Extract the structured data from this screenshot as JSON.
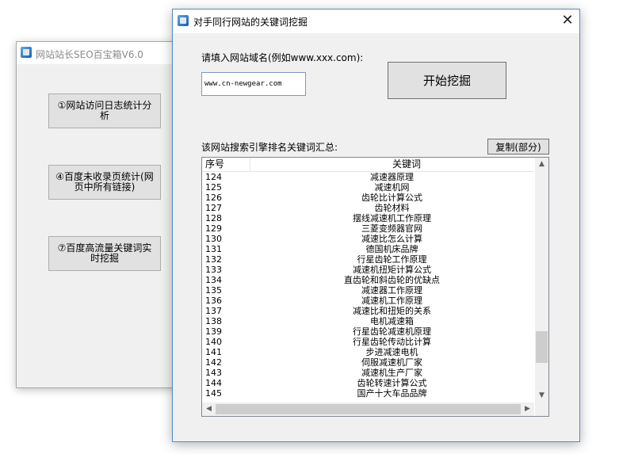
{
  "background_window": {
    "title": "网站站长SEO百宝箱V6.0",
    "buttons": [
      {
        "label": "①网站访问日志统计分析"
      },
      {
        "label": "④百度未收录页统计(网页中所有链接)"
      },
      {
        "label": "⑦百度高流量关键词实时挖掘"
      }
    ]
  },
  "dialog": {
    "title": "对手同行网站的关键词挖掘",
    "close_glyph": "✕",
    "domain_label": "请填入网站域名(例如www.xxx.com):",
    "domain_value": "www.cn-newgear.com",
    "start_button": "开始挖掘",
    "summary_label": "该网站搜索引擎排名关键词汇总:",
    "copy_button": "复制(部分)",
    "table": {
      "columns": [
        "序号",
        "关键词"
      ],
      "rows": [
        {
          "seq": "124",
          "keyword": "减速器原理"
        },
        {
          "seq": "125",
          "keyword": "减速机网"
        },
        {
          "seq": "126",
          "keyword": "齿轮比计算公式"
        },
        {
          "seq": "127",
          "keyword": "齿轮材料"
        },
        {
          "seq": "128",
          "keyword": "摆线减速机工作原理"
        },
        {
          "seq": "129",
          "keyword": "三菱变频器官网"
        },
        {
          "seq": "130",
          "keyword": "减速比怎么计算"
        },
        {
          "seq": "131",
          "keyword": "德国机床品牌"
        },
        {
          "seq": "132",
          "keyword": "行星齿轮工作原理"
        },
        {
          "seq": "133",
          "keyword": "减速机扭矩计算公式"
        },
        {
          "seq": "134",
          "keyword": "直齿轮和斜齿轮的优缺点"
        },
        {
          "seq": "135",
          "keyword": "减速器工作原理"
        },
        {
          "seq": "136",
          "keyword": "减速机工作原理"
        },
        {
          "seq": "137",
          "keyword": "减速比和扭矩的关系"
        },
        {
          "seq": "138",
          "keyword": "电机减速箱"
        },
        {
          "seq": "139",
          "keyword": "行星齿轮减速机原理"
        },
        {
          "seq": "140",
          "keyword": "行星齿轮传动比计算"
        },
        {
          "seq": "141",
          "keyword": "步进减速电机"
        },
        {
          "seq": "142",
          "keyword": "伺服减速机厂家"
        },
        {
          "seq": "143",
          "keyword": "减速机生产厂家"
        },
        {
          "seq": "144",
          "keyword": "齿轮转速计算公式"
        },
        {
          "seq": "145",
          "keyword": "国产十大车品品牌"
        }
      ]
    },
    "scroll": {
      "vertical_position": 0.86
    }
  }
}
